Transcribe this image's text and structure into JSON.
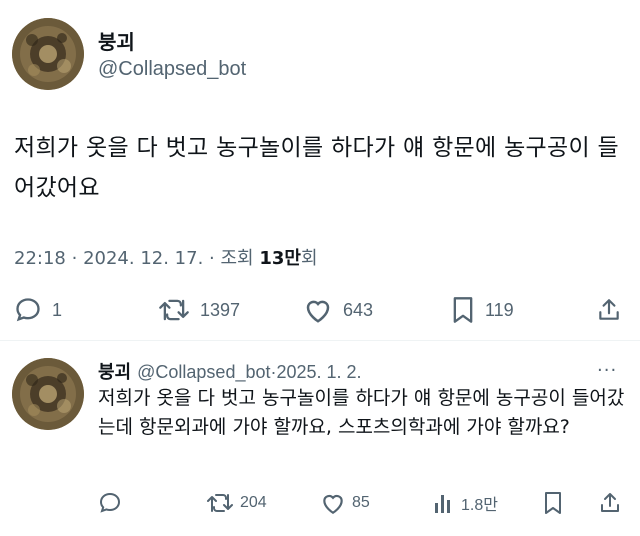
{
  "tweet": {
    "name": "붕괴",
    "handle": "@Collapsed_bot",
    "body": "저희가 옷을 다 벗고 농구놀이를 하다가 얘 항문에 농구공이 들어갔어요",
    "time": "22:18",
    "date": "2024. 12. 17.",
    "views_prefix": "조회",
    "views_count": "13만",
    "views_suffix": "회",
    "replies": "1",
    "retweets": "1397",
    "likes": "643",
    "bookmarks": "119"
  },
  "reply": {
    "name": "붕괴",
    "handle": "@Collapsed_bot",
    "date": "2025. 1. 2.",
    "more": "···",
    "body": "저희가 옷을 다 벗고 농구놀이를 하다가 얘 항문에 농구공이 들어갔는데 항문외과에 가야 할까요, 스포츠의학과에 가야 할까요?",
    "replies": "",
    "retweets": "204",
    "likes": "85",
    "views": "1.8만"
  },
  "icons": {
    "reply": "speech-bubble-icon",
    "retweet": "retweet-arrows-icon",
    "like": "heart-icon",
    "bookmark": "bookmark-icon",
    "share": "share-upload-icon",
    "views": "bar-chart-icon",
    "more": "ellipsis-icon"
  },
  "colors": {
    "text": "#0f1419",
    "secondary": "#536471",
    "divider": "#eff3f4"
  }
}
